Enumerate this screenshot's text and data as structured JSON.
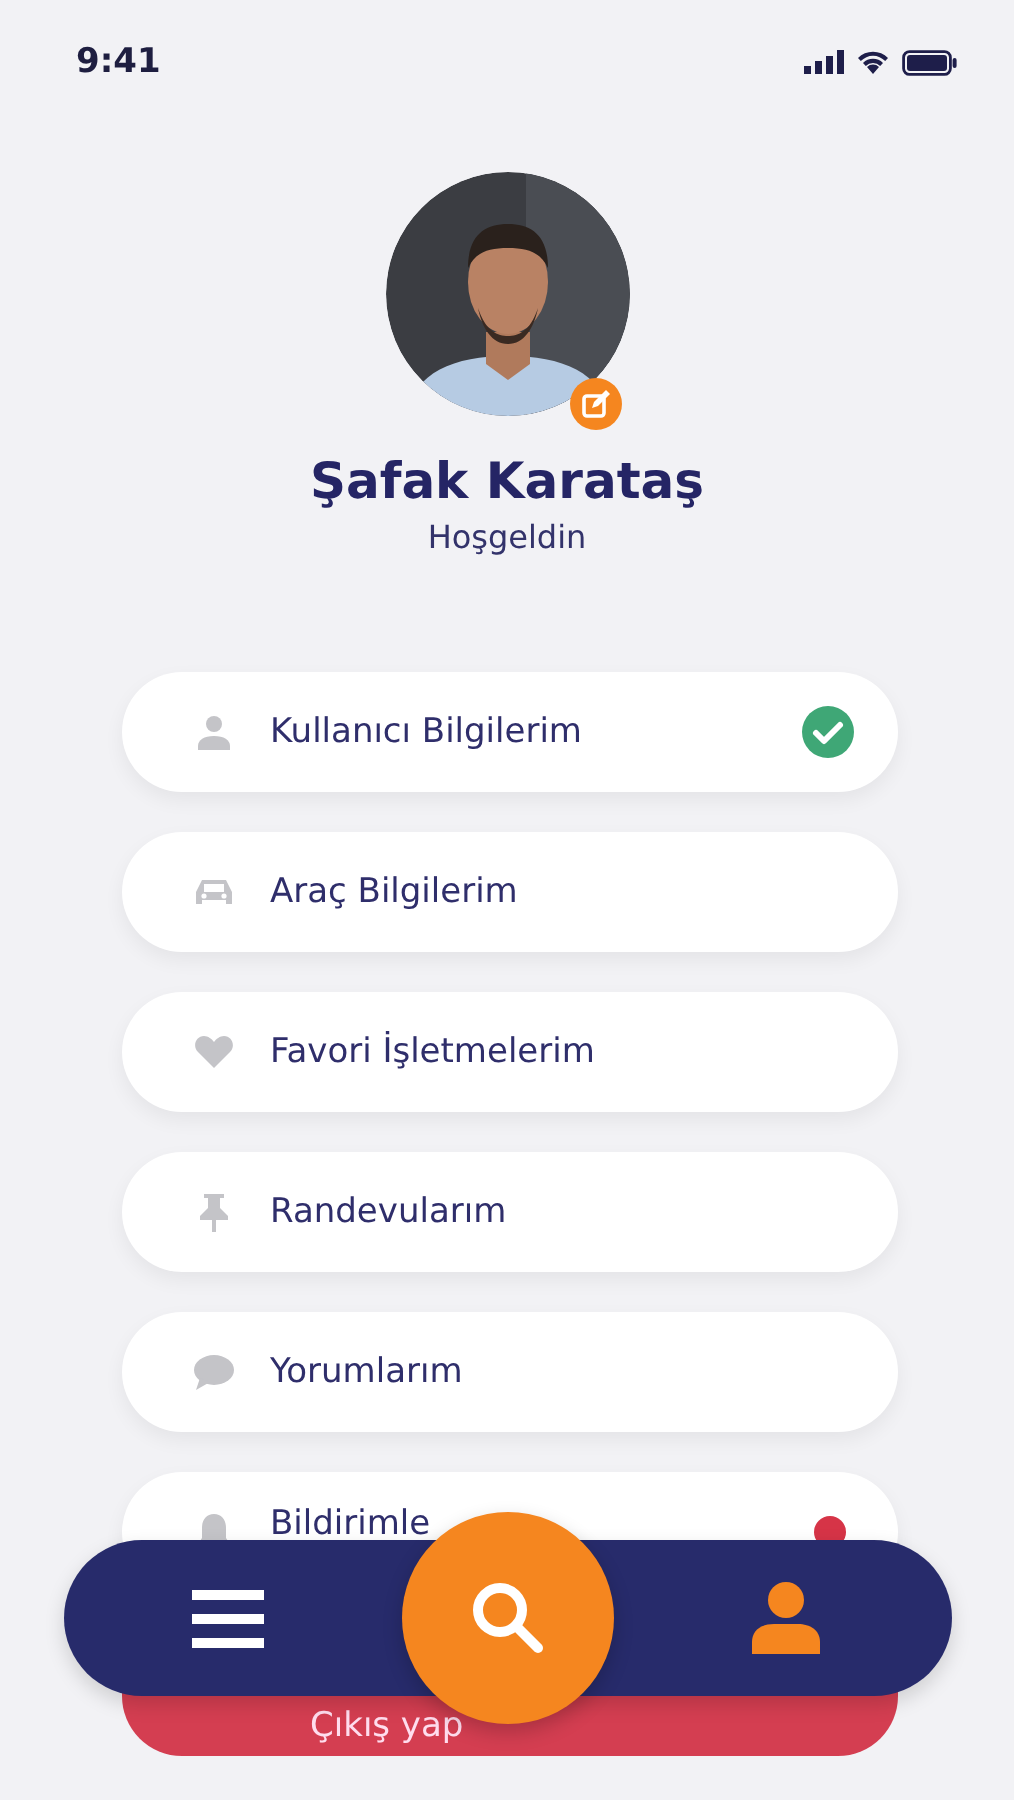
{
  "status_bar": {
    "time": "9:41"
  },
  "profile": {
    "name": "Şafak Karataş",
    "greeting": "Hoşgeldin"
  },
  "menu_items": [
    {
      "kind": "user",
      "label": "Kullanıcı Bilgilerim",
      "verified": true,
      "unread": false
    },
    {
      "kind": "car",
      "label": "Araç Bilgilerim",
      "verified": false,
      "unread": false
    },
    {
      "kind": "heart",
      "label": "Favori İşletmelerim",
      "verified": false,
      "unread": false
    },
    {
      "kind": "pin",
      "label": "Randevularım",
      "verified": false,
      "unread": false
    },
    {
      "kind": "comment",
      "label": "Yorumlarım",
      "verified": false,
      "unread": false
    },
    {
      "kind": "bell",
      "label": "Bildirimle",
      "verified": false,
      "unread": true
    }
  ],
  "logout": {
    "label": "Çıkış yap"
  },
  "bottom_nav": {
    "items": [
      {
        "kind": "menu",
        "selected": false
      },
      {
        "kind": "search",
        "selected": false
      },
      {
        "kind": "profile",
        "selected": true
      }
    ]
  }
}
